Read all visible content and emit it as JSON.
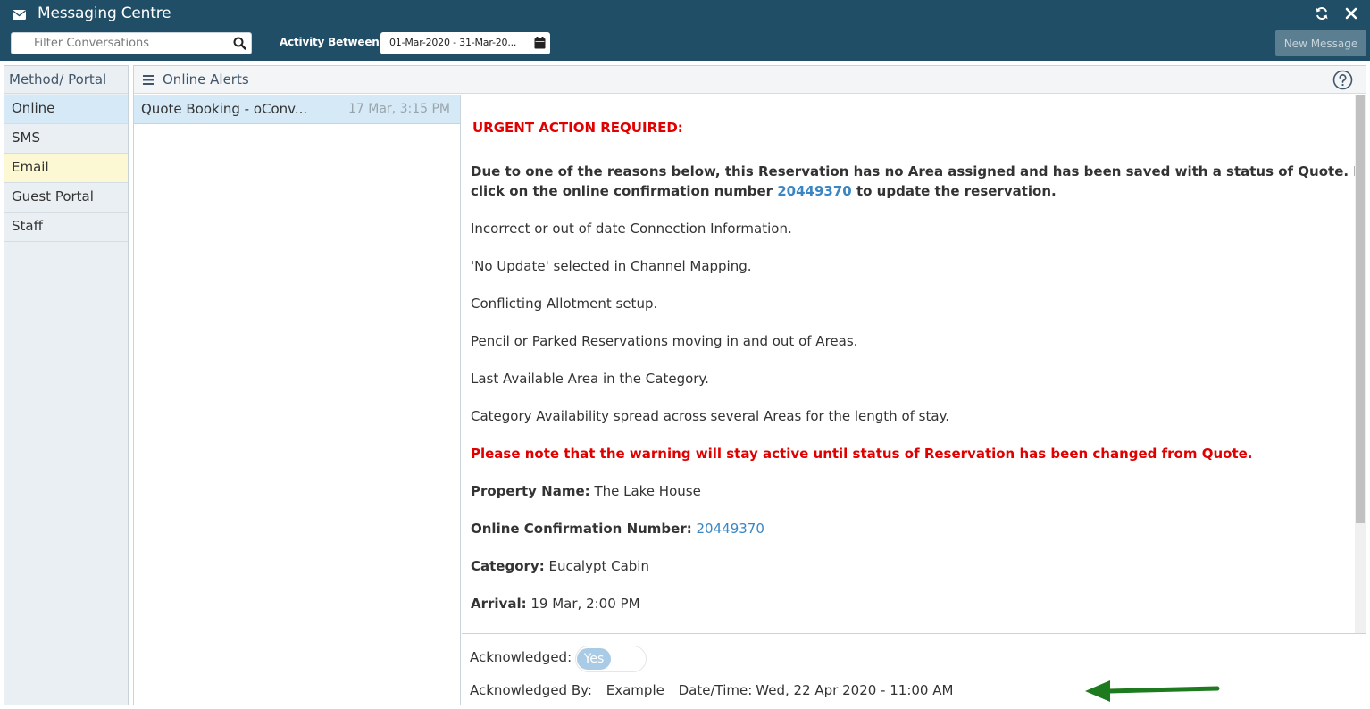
{
  "header": {
    "title": "Messaging Centre",
    "filter_placeholder": "Filter Conversations",
    "activity_label": "Activity Between:",
    "date_range": "01-Mar-2020 - 31-Mar-20...",
    "new_message": "New Message",
    "icons": [
      "mail-icon",
      "refresh-icon",
      "close-icon",
      "search-icon",
      "calendar-icon"
    ]
  },
  "sidebar": {
    "header": "Method/ Portal",
    "items": [
      {
        "label": "Online"
      },
      {
        "label": "SMS"
      },
      {
        "label": "Email"
      },
      {
        "label": "Guest Portal"
      },
      {
        "label": "Staff"
      }
    ]
  },
  "panel": {
    "title": "Online Alerts",
    "conversations": [
      {
        "subject": "Quote Booking - oConv...",
        "time": "17 Mar, 3:15 PM"
      }
    ]
  },
  "message": {
    "urgent": "URGENT ACTION REQUIRED:",
    "intro_line1": "Due to one of the reasons below, this Reservation has no Area assigned and has been saved with a status of Quote. Please",
    "intro_line2_pre": "click on the online confirmation number ",
    "intro_link": "20449370",
    "intro_line2_post": " to update the reservation.",
    "reasons": [
      "Incorrect or out of date Connection Information.",
      "'No Update' selected in Channel Mapping.",
      "Conflicting Allotment setup.",
      "Pencil or Parked Reservations moving in and out of Areas.",
      "Last Available Area in the Category.",
      "Category Availability spread across several Areas for the length of stay."
    ],
    "warning": "Please note that the warning will stay active until status of Reservation has been changed from Quote.",
    "property_label": "Property Name:",
    "property_value": "The Lake House",
    "confirmation_label": "Online Confirmation Number:",
    "confirmation_value": "20449370",
    "category_label": "Category:",
    "category_value": "Eucalypt Cabin",
    "arrival_label": "Arrival:",
    "arrival_value": "19 Mar, 2:00 PM"
  },
  "footer": {
    "acknowledged_label": "Acknowledged:",
    "acknowledged_value": "Yes",
    "ack_by_label": "Acknowledged By:",
    "ack_by_value": "Example",
    "datetime_label": "Date/Time:",
    "datetime_value": "Wed, 22 Apr 2020 - 11:00 AM"
  },
  "colors": {
    "header_bg": "#1f4e66",
    "urgent_red": "#e00000",
    "link_blue": "#3a86c4",
    "selected_bg": "#d5e9f7",
    "email_bg": "#fcf8d3",
    "arrow_green": "#1e7a1e"
  }
}
